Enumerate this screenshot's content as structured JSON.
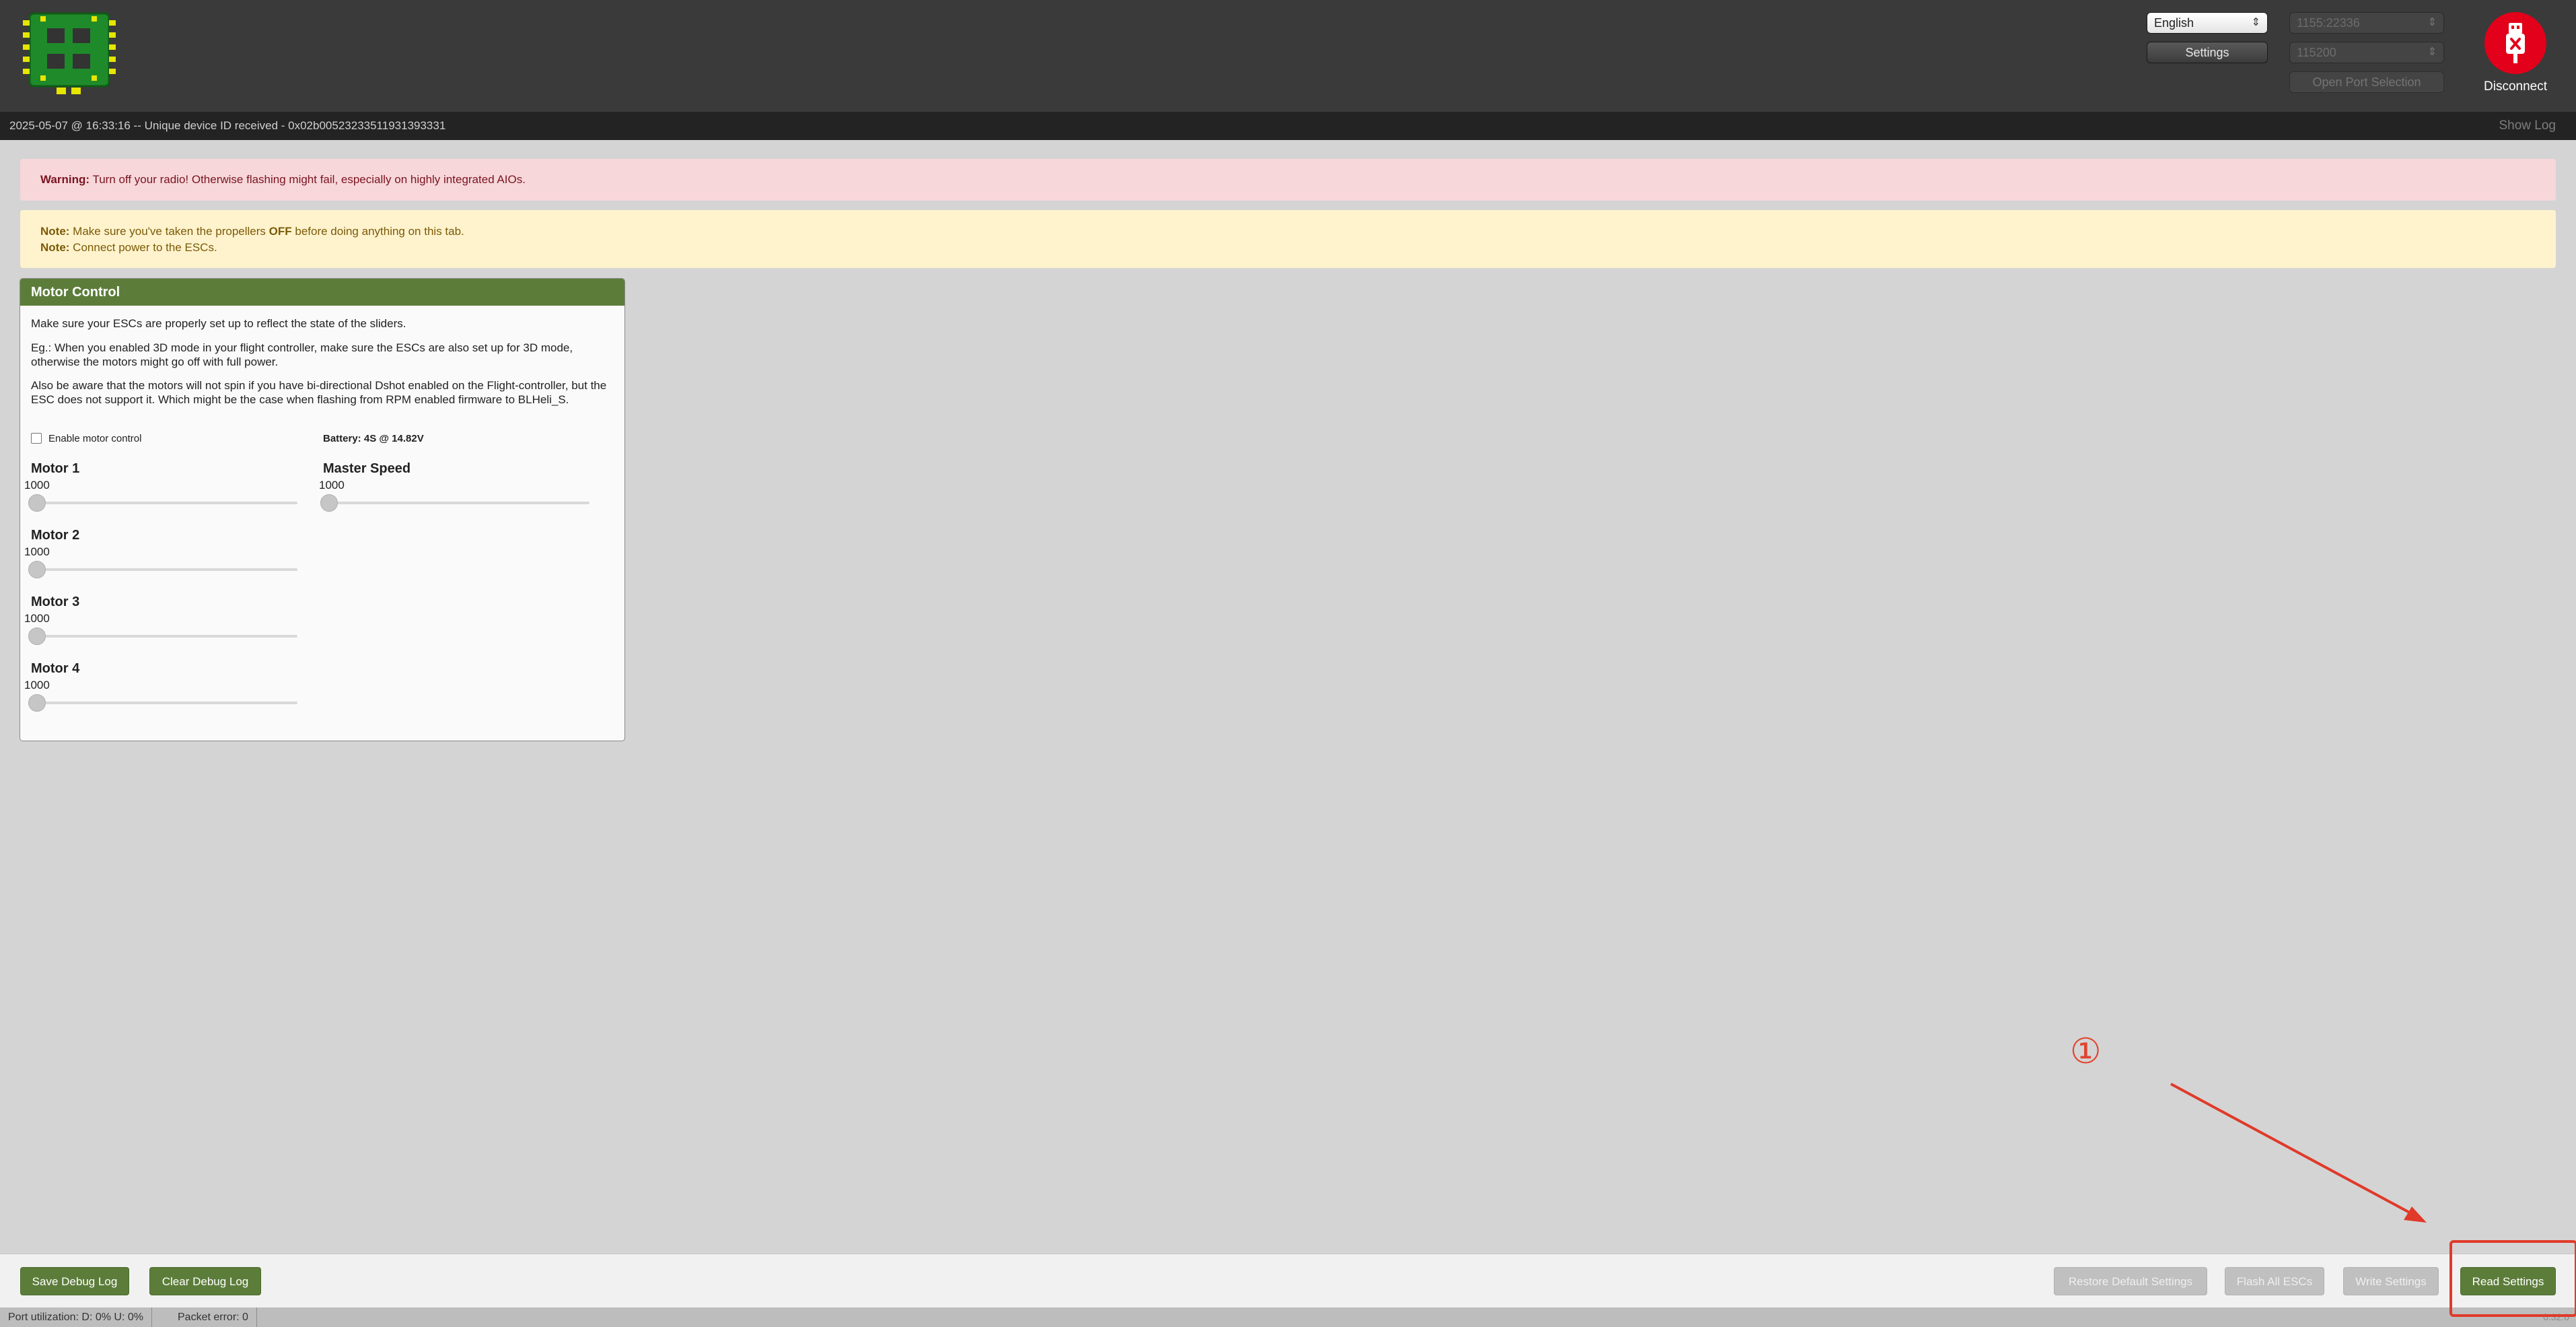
{
  "header": {
    "language": "English",
    "settings_label": "Settings",
    "port": "1155:22336",
    "baud": "115200",
    "open_port_label": "Open Port Selection",
    "disconnect_label": "Disconnect"
  },
  "log": {
    "message": "2025-05-07 @ 16:33:16 -- Unique device ID received - 0x02b00523233511931393331",
    "show_log_label": "Show Log"
  },
  "warning": {
    "bold": "Warning:",
    "text": " Turn off your radio! Otherwise flashing might fail, especially on highly integrated AIOs."
  },
  "notes": {
    "note_label": "Note:",
    "line1_pre": " Make sure you've taken the propellers ",
    "line1_bold": "OFF",
    "line1_post": " before doing anything on this tab.",
    "line2": " Connect power to the ESCs."
  },
  "motor_control": {
    "title": "Motor Control",
    "para1": "Make sure your ESCs are properly set up to reflect the state of the sliders.",
    "para2": "Eg.: When you enabled 3D mode in your flight controller, make sure the ESCs are also set up for 3D mode, otherwise the motors might go off with full power.",
    "para3": "Also be aware that the motors will not spin if you have bi-directional Dshot enabled on the Flight-controller, but the ESC does not support it. Which might be the case when flashing from RPM enabled firmware to BLHeli_S.",
    "enable_label": "Enable motor control",
    "battery": "Battery: 4S @ 14.82V",
    "motors": [
      {
        "label": "Motor 1",
        "value": "1000"
      },
      {
        "label": "Motor 2",
        "value": "1000"
      },
      {
        "label": "Motor 3",
        "value": "1000"
      },
      {
        "label": "Motor 4",
        "value": "1000"
      }
    ],
    "master": {
      "label": "Master Speed",
      "value": "1000"
    }
  },
  "toolbar": {
    "save_debug": "Save Debug Log",
    "clear_debug": "Clear Debug Log",
    "restore_default": "Restore Default Settings",
    "flash_all": "Flash All ESCs",
    "write_settings": "Write Settings",
    "read_settings": "Read Settings"
  },
  "status": {
    "port_util": "Port utilization: D: 0% U: 0%",
    "packet_error": "Packet error: 0",
    "version": "0.32.0"
  },
  "annotation": {
    "step": "①",
    "color": "#e03a2a"
  }
}
